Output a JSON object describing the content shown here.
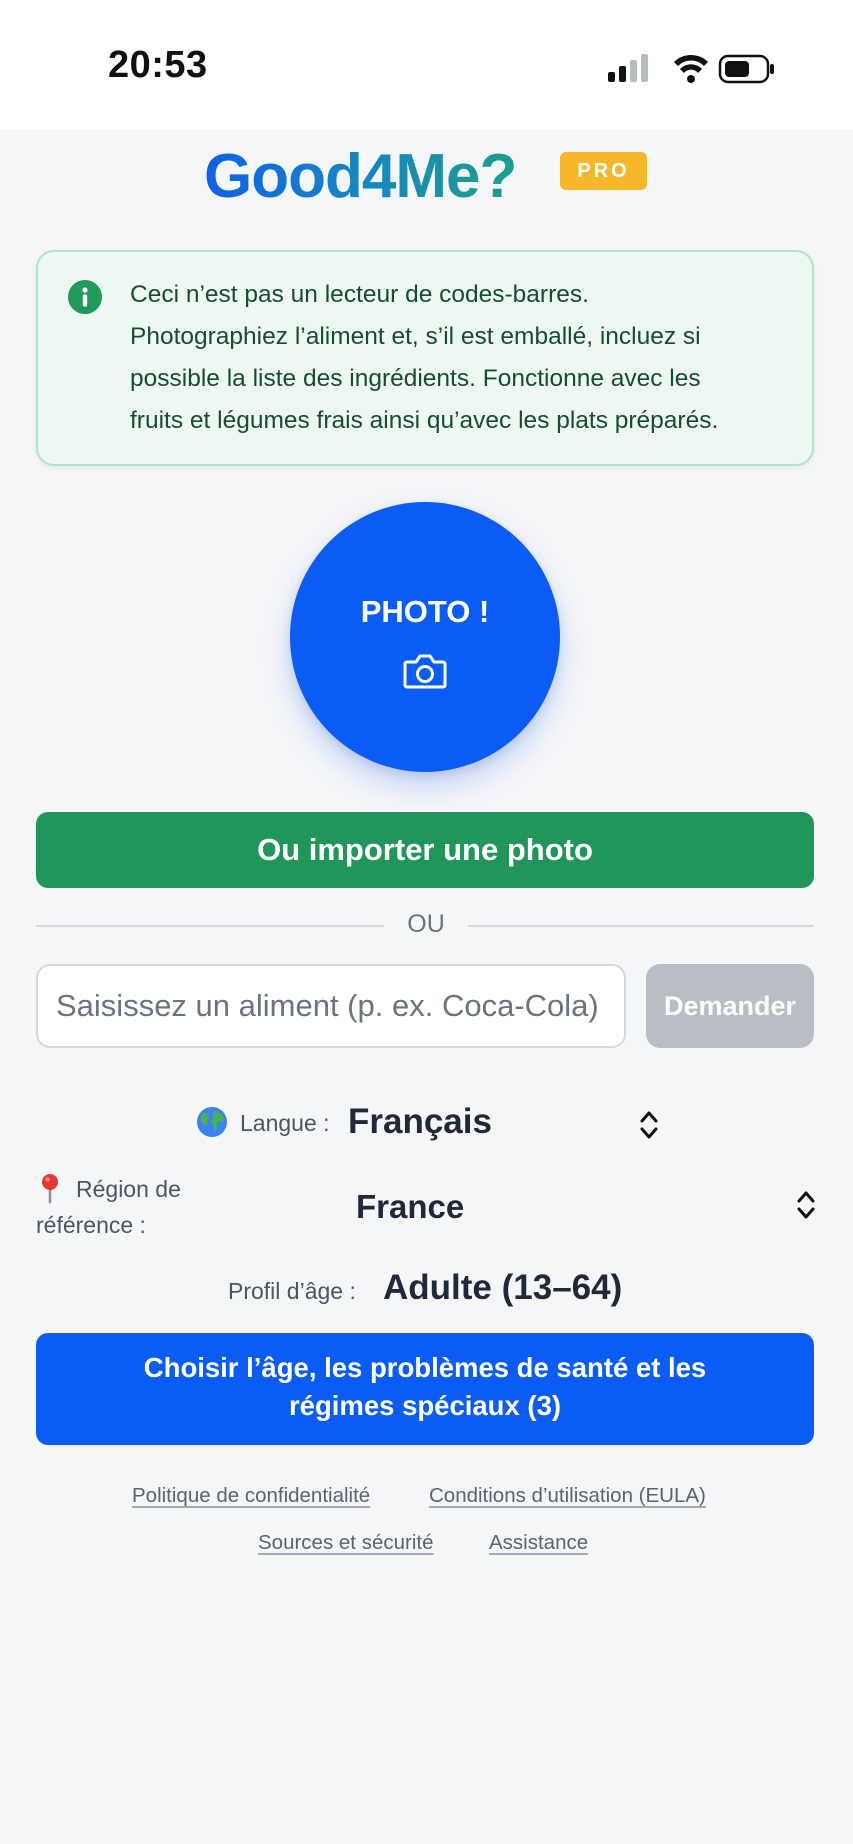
{
  "status_bar": {
    "time": "20:53"
  },
  "header": {
    "logo": "Good4Me?",
    "badge": "PRO"
  },
  "info": {
    "lines": [
      "Ceci n’est pas un lecteur de codes-barres.",
      "Photographiez l’aliment et, s’il est emballé, incluez si",
      "possible la liste des ingrédients. Fonctionne avec les",
      "fruits et légumes frais ainsi qu’avec les plats préparés."
    ]
  },
  "photo_button": {
    "label": "PHOTO !"
  },
  "import_button": {
    "label": "Ou importer une photo"
  },
  "divider": {
    "label": "OU"
  },
  "search": {
    "placeholder": "Saisissez un aliment (p. ex. Coca-Cola)",
    "value": "",
    "button_label": "Demander"
  },
  "settings": {
    "language_label": "Langue :",
    "language_value": "Français",
    "region_label_line1": "Région de",
    "region_label_line2": "référence :",
    "region_value": "France",
    "age_label": "Profil d’âge :",
    "age_value": "Adulte (13–64)"
  },
  "profile_button": {
    "line1": "Choisir l’âge, les problèmes de santé et les",
    "line2": "régimes spéciaux (3)"
  },
  "footer": {
    "privacy": "Politique de confidentialité",
    "terms": "Conditions d’utilisation (EULA)",
    "sources": "Sources et sécurité",
    "support": "Assistance"
  },
  "colors": {
    "primary_blue": "#0b5cf5",
    "green": "#21965a",
    "badge_yellow": "#f6b82a",
    "disabled_gray": "#b9bdc4"
  }
}
